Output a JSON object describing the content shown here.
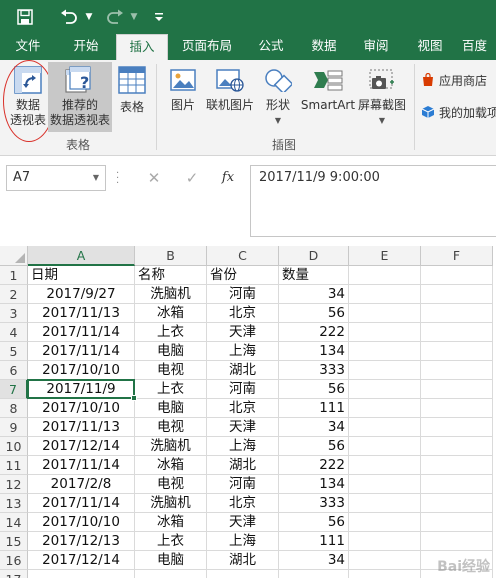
{
  "quick_access": {
    "save_icon": "save-icon",
    "undo_icon": "undo-icon",
    "redo_icon": "redo-icon",
    "customize_icon": "customize-icon"
  },
  "tabs": [
    {
      "label": "文件"
    },
    {
      "label": "开始"
    },
    {
      "label": "插入"
    },
    {
      "label": "页面布局"
    },
    {
      "label": "公式"
    },
    {
      "label": "数据"
    },
    {
      "label": "审阅"
    },
    {
      "label": "视图"
    },
    {
      "label": "百度"
    }
  ],
  "active_tab": "插入",
  "ribbon": {
    "pivot_table": {
      "line1": "数据",
      "line2": "透视表"
    },
    "recommended_pivot": {
      "line1": "推荐的",
      "line2": "数据透视表"
    },
    "table": {
      "label": "表格"
    },
    "group_tables": "表格",
    "picture": {
      "label": "图片"
    },
    "online_picture": {
      "label": "联机图片"
    },
    "shapes": {
      "label": "形状"
    },
    "smartart": {
      "label": "SmartArt"
    },
    "screenshot": {
      "label": "屏幕截图"
    },
    "group_illustrations": "插图",
    "app_store": "应用商店",
    "my_addins": "我的加载项"
  },
  "formula_bar": {
    "name_box": "A7",
    "cancel_symbol": "✕",
    "enter_symbol": "✓",
    "fx_symbol": "fx",
    "content": "2017/11/9  9:00:00"
  },
  "sheet": {
    "columns": [
      "A",
      "B",
      "C",
      "D",
      "E",
      "F"
    ],
    "row_numbers": [
      "1",
      "2",
      "3",
      "4",
      "5",
      "6",
      "7",
      "8",
      "9",
      "10",
      "11",
      "12",
      "13",
      "14",
      "15",
      "16",
      "17"
    ],
    "header": [
      "日期",
      "名称",
      "省份",
      "数量"
    ],
    "rows": [
      [
        "2017/9/27",
        "洗脑机",
        "河南",
        "34"
      ],
      [
        "2017/11/13",
        "冰箱",
        "北京",
        "56"
      ],
      [
        "2017/11/14",
        "上衣",
        "天津",
        "222"
      ],
      [
        "2017/11/14",
        "电脑",
        "上海",
        "134"
      ],
      [
        "2017/10/10",
        "电视",
        "湖北",
        "333"
      ],
      [
        "2017/11/9",
        "上衣",
        "河南",
        "56"
      ],
      [
        "2017/10/10",
        "电脑",
        "北京",
        "111"
      ],
      [
        "2017/11/13",
        "电视",
        "天津",
        "34"
      ],
      [
        "2017/12/14",
        "洗脑机",
        "上海",
        "56"
      ],
      [
        "2017/11/14",
        "冰箱",
        "湖北",
        "222"
      ],
      [
        "2017/2/8",
        "电视",
        "河南",
        "134"
      ],
      [
        "2017/11/14",
        "洗脑机",
        "北京",
        "333"
      ],
      [
        "2017/10/10",
        "冰箱",
        "天津",
        "56"
      ],
      [
        "2017/12/13",
        "上衣",
        "上海",
        "111"
      ],
      [
        "2017/12/14",
        "电脑",
        "湖北",
        "34"
      ]
    ],
    "active_cell": "A7",
    "accent_color": "#217346"
  },
  "watermark": "Bai经验"
}
